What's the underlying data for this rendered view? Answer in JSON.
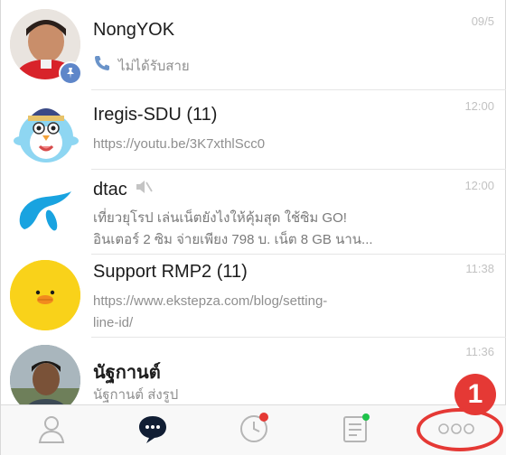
{
  "chats": [
    {
      "name": "NongYOK",
      "time": "09/5",
      "preview_icon": "phone-icon",
      "preview": "ไม่ได้รับสาย",
      "badge_icon": "pin-icon"
    },
    {
      "name": "Iregis-SDU (11)",
      "time": "12:00",
      "preview": "https://youtu.be/3K7xthlScc0"
    },
    {
      "name": "dtac",
      "muted_icon": "mute-icon",
      "time": "12:00",
      "preview_line1": "เที่ยวยุโรป เล่นเน็ตยังไงให้คุ้มสุด ใช้ซิม GO!",
      "preview_line2": "อินเตอร์ 2 ซิม จ่ายเพียง 798 บ. เน็ต 8 GB นาน..."
    },
    {
      "name": "Support RMP2 (11)",
      "time": "11:38",
      "preview_line1": "https://www.ekstepza.com/blog/setting-",
      "preview_line2": "line-id/"
    },
    {
      "name": "นัฐกานต์",
      "time": "11:36",
      "preview": "นัฐกานต์ ส่งรูป"
    }
  ],
  "tabs": [
    {
      "name": "friends",
      "icon": "person-icon"
    },
    {
      "name": "chats",
      "icon": "chat-bubble-icon",
      "active": true
    },
    {
      "name": "timeline",
      "icon": "clock-icon"
    },
    {
      "name": "news",
      "icon": "news-icon"
    },
    {
      "name": "more",
      "icon": "more-dots-icon",
      "annotation": "1"
    }
  ],
  "colors": {
    "accent_red": "#e53935",
    "active_tab": "#111e34",
    "inactive_tab": "#b5b5b5",
    "dtac_blue": "#19a3e0",
    "sally_yellow": "#f9d21a",
    "new_dot": "#1ec34b"
  }
}
